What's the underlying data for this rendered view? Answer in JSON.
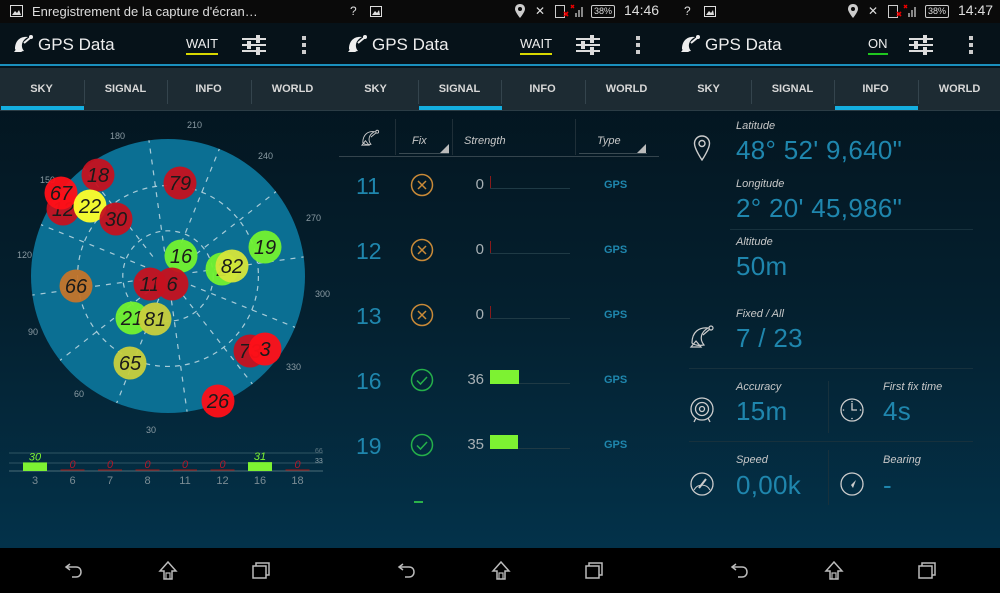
{
  "statusbar": {
    "left_panel_notification": "Enregistrement de la capture d'écran…",
    "middle": {
      "battery": "38%",
      "time": "14:46"
    },
    "right": {
      "battery": "38%",
      "time": "14:47"
    },
    "icons": [
      "wifi-question-icon",
      "image-icon",
      "location-icon",
      "bluetooth-off-icon",
      "sim-error-icon",
      "signal-icon",
      "battery-icon"
    ]
  },
  "app": {
    "title": "GPS Data",
    "tabs": [
      "SKY",
      "SIGNAL",
      "INFO",
      "WORLD"
    ],
    "accent_color": "#14aee0"
  },
  "panels": [
    {
      "id": "sky",
      "status": "WAIT",
      "status_color": "#d8d800",
      "active_tab": 0
    },
    {
      "id": "signal",
      "status": "WAIT",
      "status_color": "#d8d800",
      "active_tab": 1
    },
    {
      "id": "info",
      "status": "ON",
      "status_color": "#1fc71f",
      "active_tab": 2
    }
  ],
  "sky": {
    "azimuth_labels": [
      "30",
      "60",
      "90",
      "120",
      "150",
      "180",
      "210",
      "240",
      "270",
      "300",
      "330"
    ],
    "satellites": [
      {
        "prn": "12",
        "color": "#c5111f"
      },
      {
        "prn": "67",
        "color": "#ff0f17"
      },
      {
        "prn": "18",
        "color": "#c5111f"
      },
      {
        "prn": "22",
        "color": "#ffff2a"
      },
      {
        "prn": "30",
        "color": "#c5111f"
      },
      {
        "prn": "79",
        "color": "#c5111f"
      },
      {
        "prn": "16",
        "color": "#73f22f"
      },
      {
        "prn": "19",
        "color": "#73f22f"
      },
      {
        "prn": "2",
        "color": "#73f22f"
      },
      {
        "prn": "82",
        "color": "#d6e53a"
      },
      {
        "prn": "66",
        "color": "#c4742a"
      },
      {
        "prn": "11",
        "color": "#c5111f"
      },
      {
        "prn": "6",
        "color": "#c5111f"
      },
      {
        "prn": "21",
        "color": "#73f22f"
      },
      {
        "prn": "81",
        "color": "#c9cf3c"
      },
      {
        "prn": "65",
        "color": "#c9cf3c"
      },
      {
        "prn": "73",
        "color": "#c5111f"
      },
      {
        "prn": "3",
        "color": "#ff0f17"
      },
      {
        "prn": "26",
        "color": "#ff0f17"
      }
    ],
    "signal_bar_chart": {
      "categories": [
        "3",
        "6",
        "7",
        "8",
        "11",
        "12",
        "16",
        "18"
      ],
      "values": [
        30,
        0,
        0,
        0,
        0,
        0,
        31,
        0
      ],
      "scale_labels": [
        "66",
        "33"
      ],
      "y_max": 66
    }
  },
  "signal": {
    "columns": {
      "fix": "Fix",
      "strength": "Strength",
      "type": "Type"
    },
    "rows": [
      {
        "prn": "11",
        "fixed": false,
        "strength": 0,
        "type": "GPS"
      },
      {
        "prn": "12",
        "fixed": false,
        "strength": 0,
        "type": "GPS"
      },
      {
        "prn": "13",
        "fixed": false,
        "strength": 0,
        "type": "GPS"
      },
      {
        "prn": "16",
        "fixed": true,
        "strength": 36,
        "type": "GPS"
      },
      {
        "prn": "19",
        "fixed": true,
        "strength": 35,
        "type": "GPS"
      }
    ],
    "strength_max": 99
  },
  "info": {
    "latitude": {
      "label": "Latitude",
      "value": "48° 52' 9,640\""
    },
    "longitude": {
      "label": "Longitude",
      "value": "2° 20' 45,986\""
    },
    "altitude": {
      "label": "Altitude",
      "value": "50m"
    },
    "fixed_all": {
      "label": "Fixed / All",
      "value": "7 / 23"
    },
    "accuracy": {
      "label": "Accuracy",
      "value": "15m"
    },
    "first_fix": {
      "label": "First fix time",
      "value": "4s"
    },
    "speed": {
      "label": "Speed",
      "value": "0,00k"
    },
    "bearing": {
      "label": "Bearing",
      "value": "-"
    }
  },
  "navbar": [
    "back",
    "home",
    "recents"
  ]
}
